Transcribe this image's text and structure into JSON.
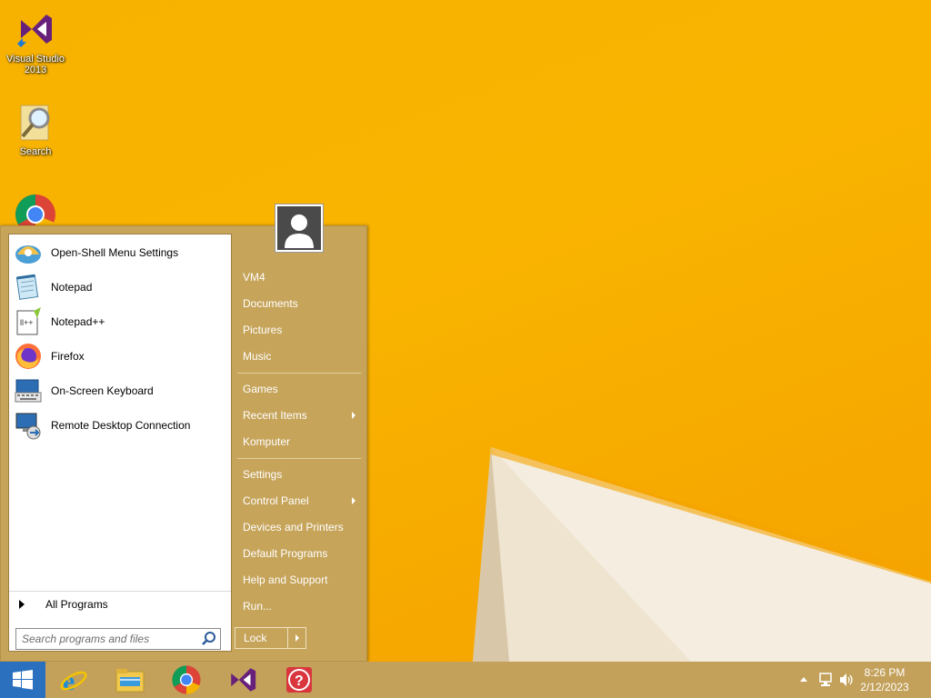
{
  "desktop": {
    "icons": [
      {
        "label": "Visual Studio 2013",
        "icon": "visual-studio-icon"
      },
      {
        "label": "Search",
        "icon": "search-magnifier-icon"
      },
      {
        "label": "",
        "icon": "chrome-icon"
      }
    ]
  },
  "start_menu": {
    "programs": [
      {
        "label": "Open-Shell Menu Settings",
        "icon": "open-shell-icon"
      },
      {
        "label": "Notepad",
        "icon": "notepad-icon"
      },
      {
        "label": "Notepad++",
        "icon": "notepad-plus-plus-icon"
      },
      {
        "label": "Firefox",
        "icon": "firefox-icon"
      },
      {
        "label": "On-Screen Keyboard",
        "icon": "keyboard-icon"
      },
      {
        "label": "Remote Desktop Connection",
        "icon": "remote-desktop-icon"
      }
    ],
    "all_programs": "All Programs",
    "search_placeholder": "Search programs and files",
    "right_items": {
      "user": "VM4",
      "documents": "Documents",
      "pictures": "Pictures",
      "music": "Music",
      "games": "Games",
      "recent_items": "Recent Items",
      "computer": "Komputer",
      "settings": "Settings",
      "control_panel": "Control Panel",
      "devices_printers": "Devices and Printers",
      "default_programs": "Default Programs",
      "help_support": "Help and Support",
      "run": "Run..."
    },
    "lock_label": "Lock"
  },
  "taskbar": {
    "pinned": [
      "internet-explorer-icon",
      "file-explorer-icon",
      "chrome-icon",
      "visual-studio-icon",
      "help-icon"
    ],
    "time": "8:26 PM",
    "date": "2/12/2023"
  },
  "colors": {
    "wallpaper": "#f9b400",
    "menu_bg": "#c6a45a",
    "taskbar_bg": "#c3a15a"
  }
}
